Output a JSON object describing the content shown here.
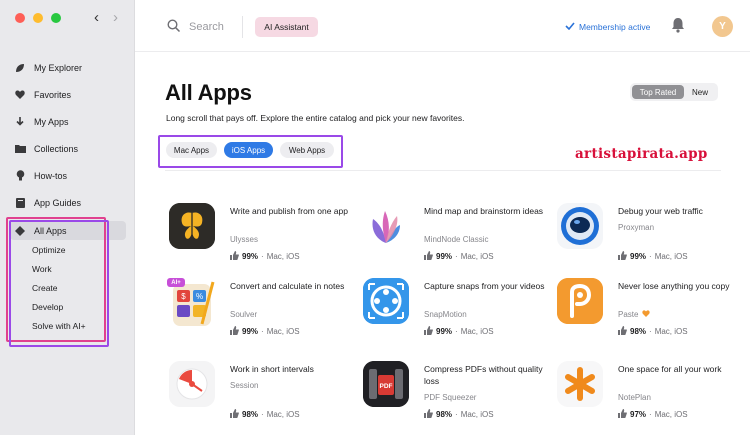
{
  "colors": {
    "accent": "#2f7ae5",
    "close": "#fe5f57",
    "minimize": "#febc2e",
    "zoom": "#28c840",
    "highlight": "#9a49e8",
    "highlight_pink": "#e0418f",
    "watermark": "#d8103a"
  },
  "nav": {
    "back": "‹",
    "forward": "›"
  },
  "sidebar": {
    "items": [
      {
        "label": "My Explorer",
        "icon": "leaf-icon"
      },
      {
        "label": "Favorites",
        "icon": "heart-icon"
      },
      {
        "label": "My Apps",
        "icon": "download-arrow-icon"
      },
      {
        "label": "Collections",
        "icon": "folder-icon"
      },
      {
        "label": "How-tos",
        "icon": "lightbulb-icon"
      },
      {
        "label": "App Guides",
        "icon": "book-icon"
      },
      {
        "label": "All Apps",
        "icon": "diamond-icon",
        "active": true
      }
    ],
    "sub_items": [
      "Optimize",
      "Work",
      "Create",
      "Develop",
      "Solve with AI+"
    ]
  },
  "topbar": {
    "search_placeholder": "Search",
    "ai_button": "AI Assistant",
    "membership": "Membership active",
    "avatar_initial": "Y"
  },
  "page": {
    "title": "All Apps",
    "subtitle": "Long scroll that pays off. Explore the entire catalog and pick your new favorites.",
    "sort": {
      "top_rated": "Top Rated",
      "new": "New",
      "selected": "Top Rated"
    },
    "filters": [
      {
        "label": "Mac Apps",
        "selected": false
      },
      {
        "label": "iOS Apps",
        "selected": true
      },
      {
        "label": "Web Apps",
        "selected": false
      }
    ],
    "watermark": "artistapirata.app"
  },
  "apps": [
    {
      "title": "Write and publish from one app",
      "developer": "Ulysses",
      "rating": "99%",
      "platforms": "Mac, iOS",
      "icon": "ulysses-butterfly-icon"
    },
    {
      "title": "Mind map and brainstorm ideas",
      "developer": "MindNode Classic",
      "rating": "99%",
      "platforms": "Mac, iOS",
      "icon": "mindnode-petals-icon"
    },
    {
      "title": "Debug your web traffic",
      "developer": "Proxyman",
      "rating": "99%",
      "platforms": "Mac, iOS",
      "icon": "proxyman-astronaut-icon"
    },
    {
      "title": "Convert and calculate in notes",
      "developer": "Soulver",
      "rating": "99%",
      "platforms": "Mac, iOS",
      "icon": "soulver-calculator-icon",
      "badge": "AI+"
    },
    {
      "title": "Capture snaps from your videos",
      "developer": "SnapMotion",
      "rating": "99%",
      "platforms": "Mac, iOS",
      "icon": "snapmotion-reel-icon"
    },
    {
      "title": "Never lose anything you copy",
      "developer": "Paste",
      "rating": "98%",
      "platforms": "Mac, iOS",
      "icon": "paste-clip-icon",
      "favorite": true
    },
    {
      "title": "Work in short intervals",
      "developer": "Session",
      "rating": "98%",
      "platforms": "Mac, iOS",
      "icon": "session-timer-icon"
    },
    {
      "title": "Compress PDFs without quality loss",
      "developer": "PDF Squeezer",
      "rating": "98%",
      "platforms": "Mac, iOS",
      "icon": "pdf-squeezer-icon"
    },
    {
      "title": "One space for all your work",
      "developer": "NotePlan",
      "rating": "97%",
      "platforms": "Mac, iOS",
      "icon": "noteplan-asterisk-icon"
    }
  ]
}
